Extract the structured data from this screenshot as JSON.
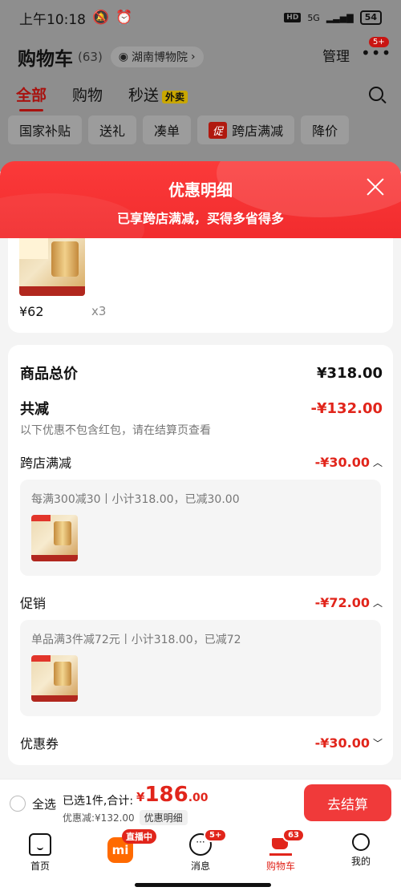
{
  "status_bar": {
    "time": "上午10:18",
    "icons_left": [
      "mute-icon",
      "alarm-icon"
    ],
    "network": "5G",
    "battery": "54"
  },
  "header": {
    "title": "购物车",
    "count": "(63)",
    "location": "湖南博物院",
    "manage": "管理",
    "more_badge": "5+"
  },
  "tabs": [
    {
      "label": "全部",
      "active": true
    },
    {
      "label": "购物",
      "active": false
    },
    {
      "label": "秒送",
      "active": false,
      "tag": "外卖"
    }
  ],
  "filters": [
    "国家补贴",
    "送礼",
    "凑单",
    "跨店满减",
    "降价"
  ],
  "filter_promo_tag": "促",
  "sheet": {
    "title": "优惠明细",
    "subtitle": "已享跨店满减，买得多省得多"
  },
  "product": {
    "price": "¥62",
    "qty": "x3"
  },
  "summary": {
    "total_label": "商品总价",
    "total_value": "¥318.00",
    "reduce_label": "共减",
    "reduce_value": "-¥132.00",
    "note": "以下优惠不包含红包，请在结算页查看",
    "items": [
      {
        "label": "跨店满减",
        "value": "-¥30.00",
        "detail": "每满300减30丨小计318.00，已减30.00"
      },
      {
        "label": "促销",
        "value": "-¥72.00",
        "detail": "单品满3件减72元丨小计318.00，已减72"
      },
      {
        "label": "优惠券",
        "value": "-¥30.00"
      }
    ]
  },
  "action_bar": {
    "select_all": "全选",
    "selected": "已选1件,合计:",
    "currency": "¥",
    "total_int": "186",
    "total_dec": ".00",
    "discount": "优惠减:¥132.00",
    "discount_btn": "优惠明细",
    "checkout": "去结算"
  },
  "nav": {
    "home": "首页",
    "live": "直播中",
    "messages": "消息",
    "messages_badge": "5+",
    "cart": "购物车",
    "cart_badge": "63",
    "me": "我的"
  },
  "colors": {
    "accent_red": "#e1251b",
    "sheet_red": "#f12b2d",
    "checkout_red": "#f03a3a",
    "dim_overlay": "#8e8e8e"
  }
}
